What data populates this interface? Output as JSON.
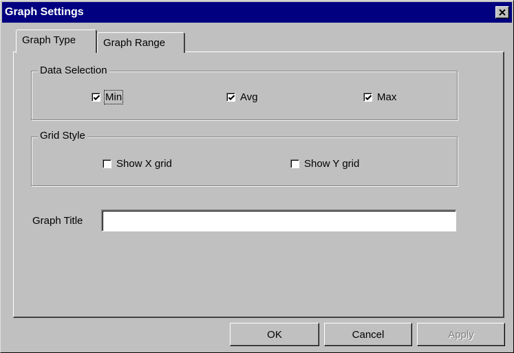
{
  "window": {
    "title": "Graph Settings"
  },
  "tabs": [
    {
      "label": "Graph Type",
      "active": true
    },
    {
      "label": "Graph Range",
      "active": false
    }
  ],
  "data_selection": {
    "label": "Data Selection",
    "options": [
      {
        "label": "Min",
        "checked": true
      },
      {
        "label": "Avg",
        "checked": true
      },
      {
        "label": "Max",
        "checked": true
      }
    ]
  },
  "grid_style": {
    "label": "Grid Style",
    "options": [
      {
        "label": "Show X grid",
        "checked": false
      },
      {
        "label": "Show Y grid",
        "checked": false
      }
    ]
  },
  "graph_title": {
    "label": "Graph Title",
    "value": ""
  },
  "buttons": {
    "ok": "OK",
    "cancel": "Cancel",
    "apply": "Apply"
  }
}
